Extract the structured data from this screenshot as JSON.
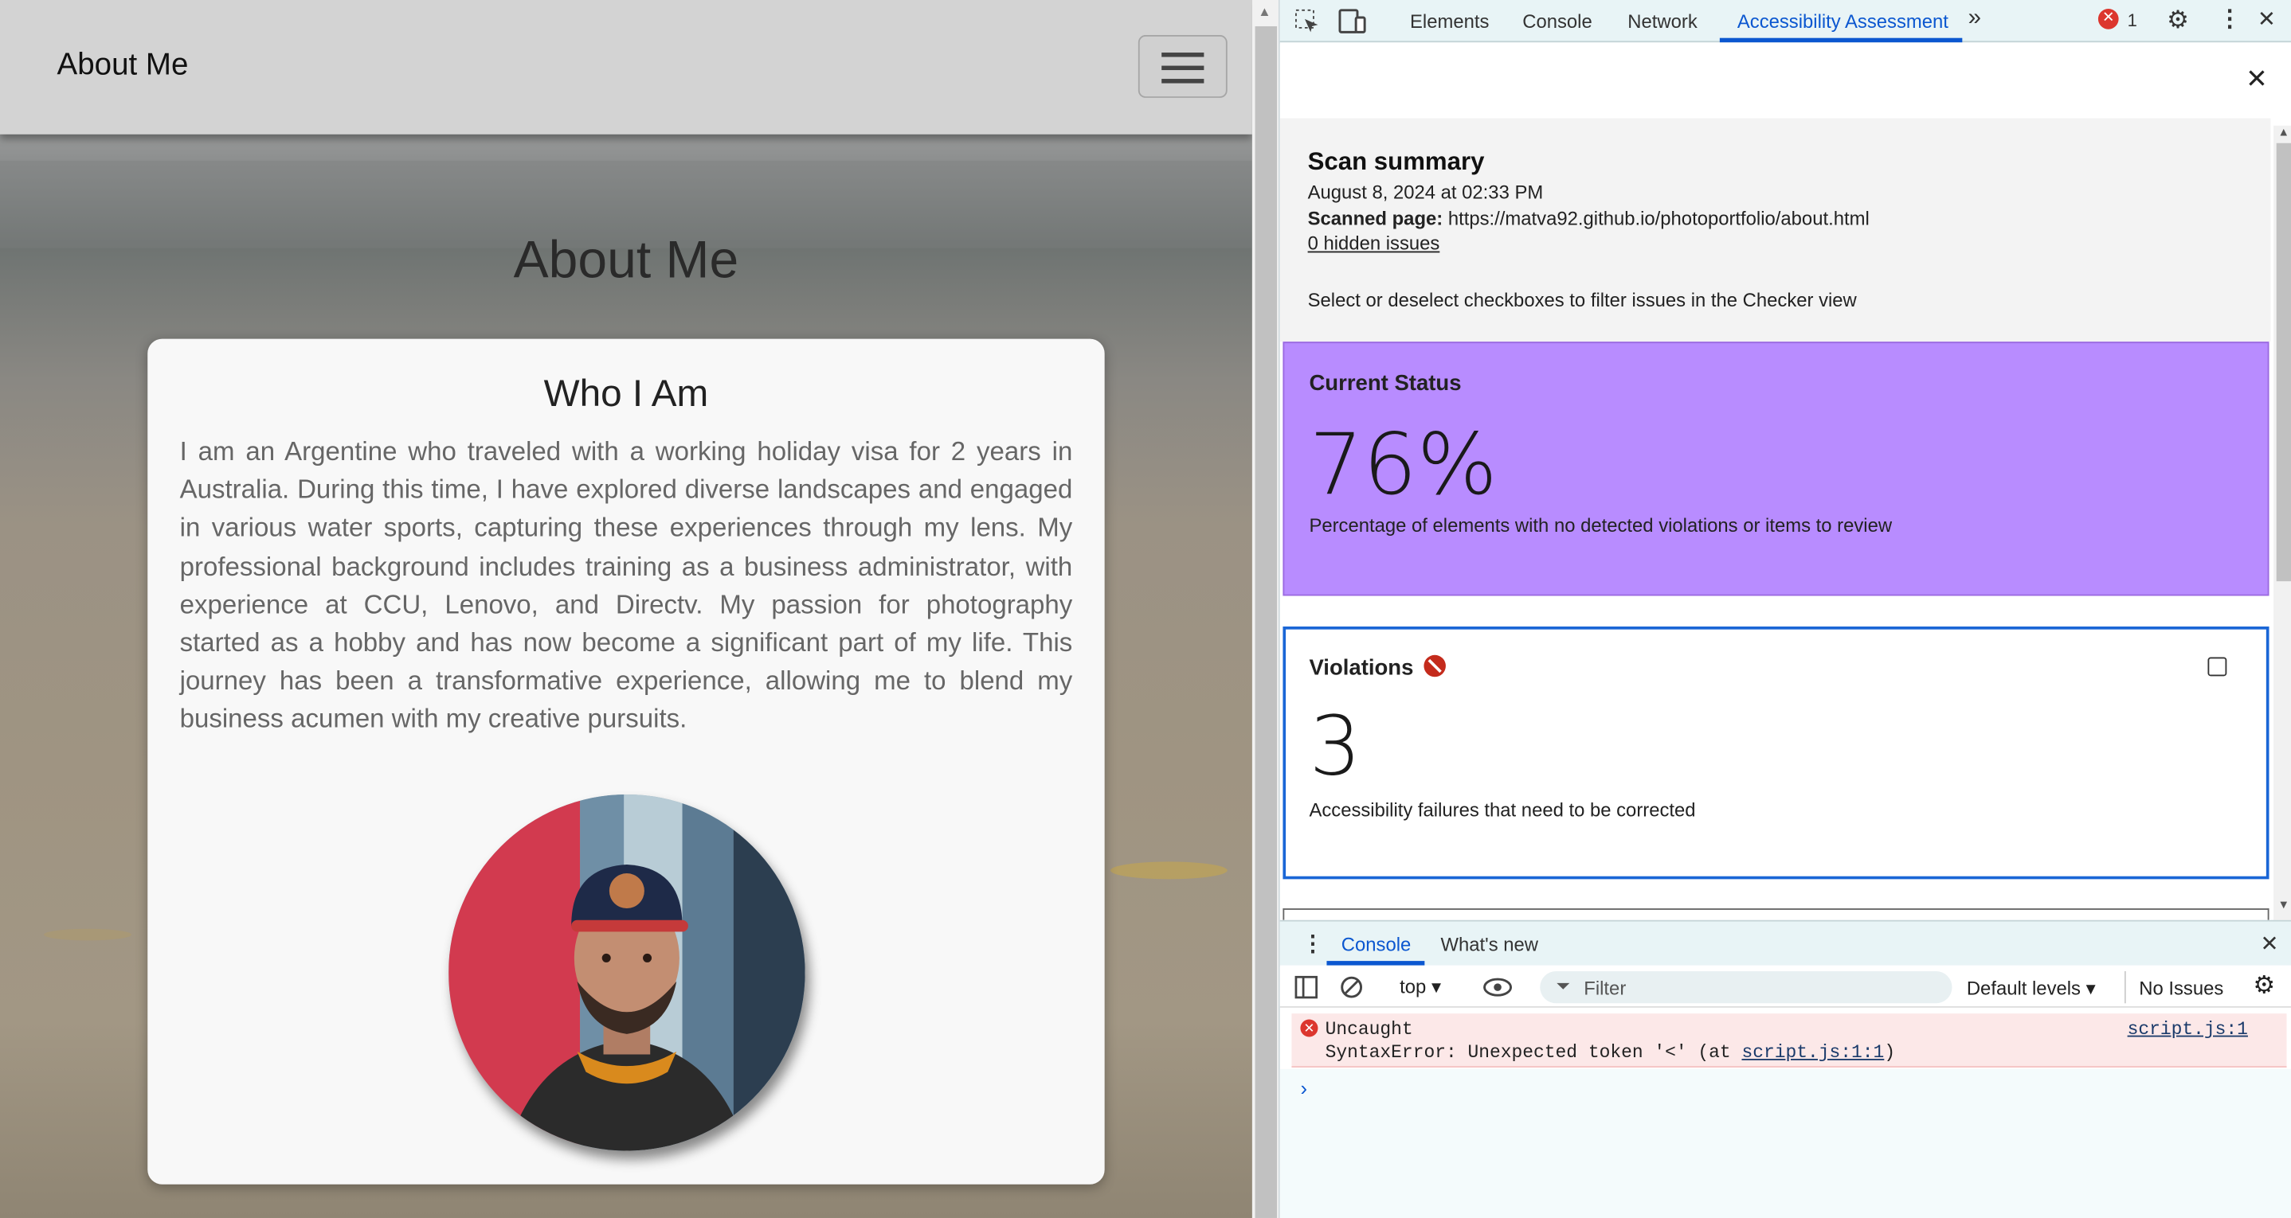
{
  "webpage": {
    "navbar": {
      "brand": "About Me"
    },
    "page_title": "About Me",
    "card": {
      "title": "Who I Am",
      "body": "I am an Argentine who traveled with a working holiday visa for 2 years in Australia. During this time, I have explored diverse landscapes and engaged in various water sports, capturing these experiences through my lens. My professional background includes training as a business administrator, with experience at CCU, Lenovo, and Directv. My passion for photography started as a hobby and has now become a significant part of my life. This journey has been a transformative experience, allowing me to blend my business acumen with my creative pursuits."
    }
  },
  "devtools": {
    "tabs": [
      "Elements",
      "Console",
      "Network",
      "Accessibility Assessment"
    ],
    "active_tab": "Accessibility Assessment",
    "error_count": "1",
    "scan": {
      "title": "Scan summary",
      "date": "August 8, 2024 at 02:33 PM",
      "scanned_label": "Scanned page:",
      "scanned_url": "https://matva92.github.io/photoportfolio/about.html",
      "hidden_issues": "0 hidden issues",
      "hint": "Select or deselect checkboxes to filter issues in the Checker view"
    },
    "current_status": {
      "title": "Current Status",
      "value": "76%",
      "description": "Percentage of elements with no detected violations or items to review",
      "color": "#b88cff"
    },
    "violations": {
      "title": "Violations",
      "value": "3",
      "description": "Accessibility failures that need to be corrected"
    },
    "drawer": {
      "tabs": [
        "Console",
        "What's new"
      ],
      "context": "top",
      "filter_placeholder": "Filter",
      "levels": "Default levels",
      "issues": "No Issues",
      "error": {
        "line1": "Uncaught",
        "line2_prefix": "SyntaxError: Unexpected token '<' (at ",
        "line2_link": "script.js:1:1",
        "line2_suffix": ")",
        "source": "script.js:1"
      }
    }
  }
}
